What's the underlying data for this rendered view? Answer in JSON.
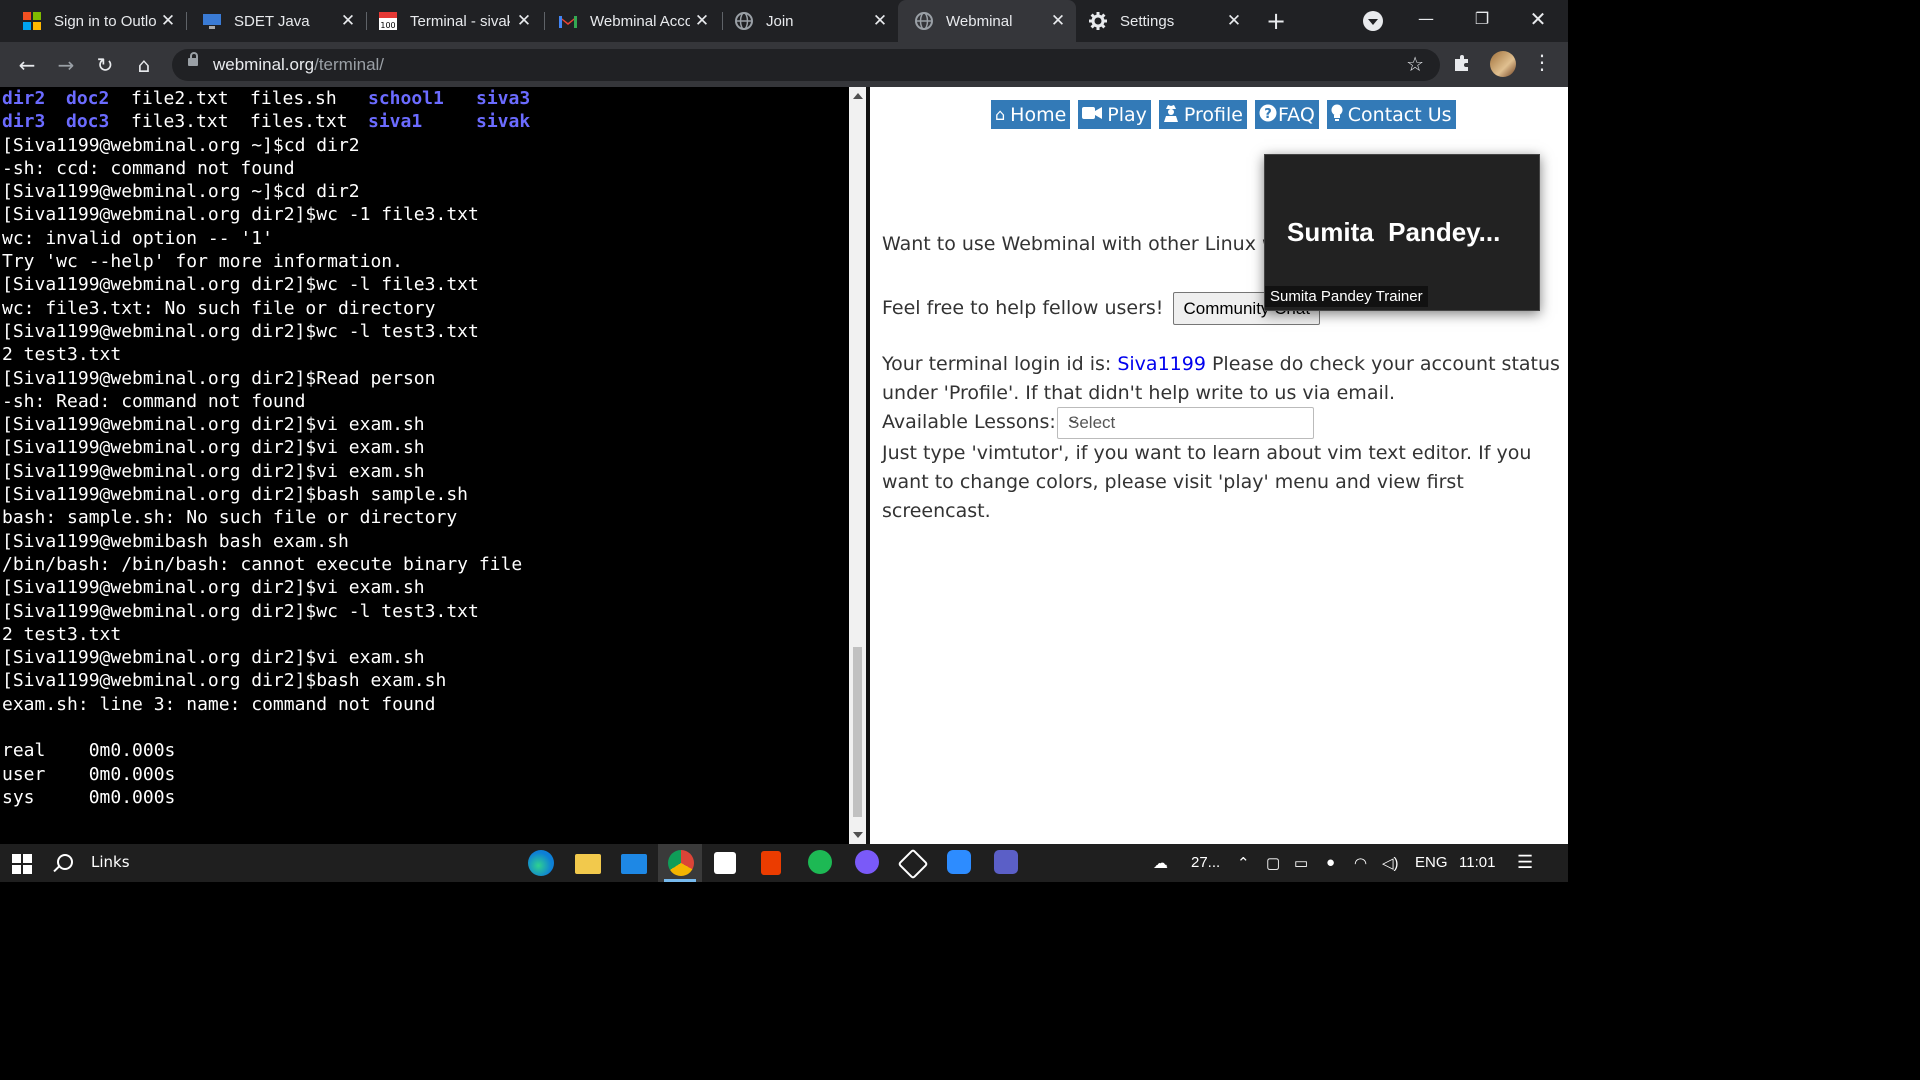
{
  "browser": {
    "tabs": [
      {
        "title": "Sign in to Outlo",
        "icon": "microsoft-logo-icon"
      },
      {
        "title": "SDET Java",
        "icon": "desktop-icon"
      },
      {
        "title": "Terminal - sivak",
        "icon": "calendar-100-icon"
      },
      {
        "title": "Webminal Acco",
        "icon": "gmail-icon"
      },
      {
        "title": "Join",
        "icon": "globe-icon"
      },
      {
        "title": "Webminal",
        "icon": "globe-icon",
        "active": true
      },
      {
        "title": "Settings",
        "icon": "gear-icon"
      }
    ],
    "url_host": "webminal.org",
    "url_path": "/terminal/"
  },
  "terminal": {
    "ls_rows": [
      [
        "dir2",
        "doc2",
        "file2.txt",
        "files.sh",
        "school1",
        "siva3"
      ],
      [
        "dir3",
        "doc3",
        "file3.txt",
        "files.txt",
        "siva1",
        "sivak"
      ]
    ],
    "lines": [
      "[Siva1199@webminal.org ~]$cd dir2",
      "-sh: ccd: command not found",
      "[Siva1199@webminal.org ~]$cd dir2",
      "[Siva1199@webminal.org dir2]$wc -1 file3.txt",
      "wc: invalid option -- '1'",
      "Try 'wc --help' for more information.",
      "[Siva1199@webminal.org dir2]$wc -l file3.txt",
      "wc: file3.txt: No such file or directory",
      "[Siva1199@webminal.org dir2]$wc -l test3.txt",
      "2 test3.txt",
      "[Siva1199@webminal.org dir2]$Read person",
      "-sh: Read: command not found",
      "[Siva1199@webminal.org dir2]$vi exam.sh",
      "[Siva1199@webminal.org dir2]$vi exam.sh",
      "[Siva1199@webminal.org dir2]$vi exam.sh",
      "[Siva1199@webminal.org dir2]$bash sample.sh",
      "bash: sample.sh: No such file or directory",
      "[Siva1199@webmibash bash exam.sh",
      "/bin/bash: /bin/bash: cannot execute binary file",
      "[Siva1199@webminal.org dir2]$vi exam.sh",
      "[Siva1199@webminal.org dir2]$wc -l test3.txt",
      "2 test3.txt",
      "[Siva1199@webminal.org dir2]$vi exam.sh",
      "[Siva1199@webminal.org dir2]$bash exam.sh",
      "exam.sh: line 3: name: command not found",
      "",
      "real    0m0.000s",
      "user    0m0.000s",
      "sys     0m0.000s"
    ]
  },
  "webpage": {
    "nav": [
      "Home",
      "Play",
      "Profile",
      "FAQ",
      "Contact Us"
    ],
    "other_linux_text": "Want to use Webminal with other Linux w",
    "help_text": "Feel free to help fellow users!",
    "community_button": "Community Chat",
    "login_prefix": "Your terminal login id is: ",
    "login_id": "Siva1199",
    "login_suffix": " Please do check your account status",
    "login_line2": "under 'Profile'. If that didn't help write to us via email.",
    "lessons_label": "Available Lessons:",
    "lessons_select": "Select",
    "vimtutor_line1": "Just type 'vimtutor', if you want to learn about vim text editor. If you",
    "vimtutor_line2": "want to change colors, please visit 'play' menu and view first",
    "vimtutor_line3": "screencast."
  },
  "video_popup": {
    "name": "Sumita  Pandey...",
    "caption": "Sumita Pandey Trainer"
  },
  "taskbar": {
    "search_label": "Links",
    "weather": "27...",
    "language": "ENG",
    "time": "11:01"
  },
  "colors": {
    "nav_blue": "#337ab7",
    "ls_blue": "#6b6bff",
    "link_blue": "#0000ee"
  }
}
